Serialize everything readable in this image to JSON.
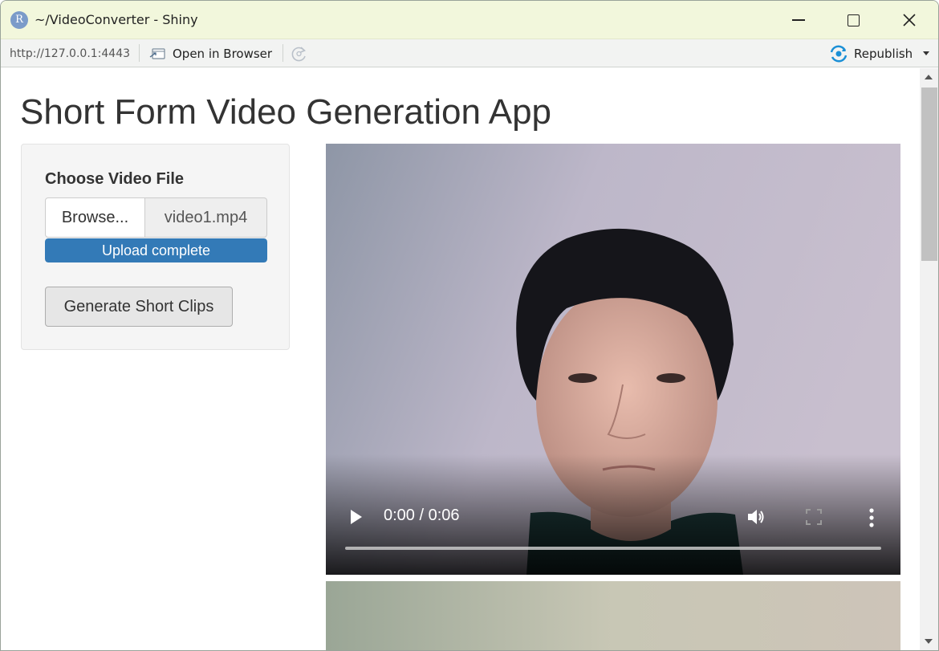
{
  "window": {
    "title": "~/VideoConverter - Shiny",
    "app_icon_letter": "R"
  },
  "toolbar": {
    "url": "http://127.0.0.1:4443",
    "open_in_browser_label": "Open in Browser",
    "republish_label": "Republish"
  },
  "page": {
    "title": "Short Form Video Generation App"
  },
  "sidebar": {
    "file_input_label": "Choose Video File",
    "browse_label": "Browse...",
    "file_name": "video1.mp4",
    "upload_status": "Upload complete",
    "upload_progress_percent": 100,
    "generate_button_label": "Generate Short Clips"
  },
  "video_player": {
    "time_display": "0:00 / 0:06",
    "progress_fraction": 0
  },
  "colors": {
    "titlebar_bg": "#f2f7dc",
    "progress_bar": "#337ab7",
    "republish_accent": "#1a8fd6"
  }
}
